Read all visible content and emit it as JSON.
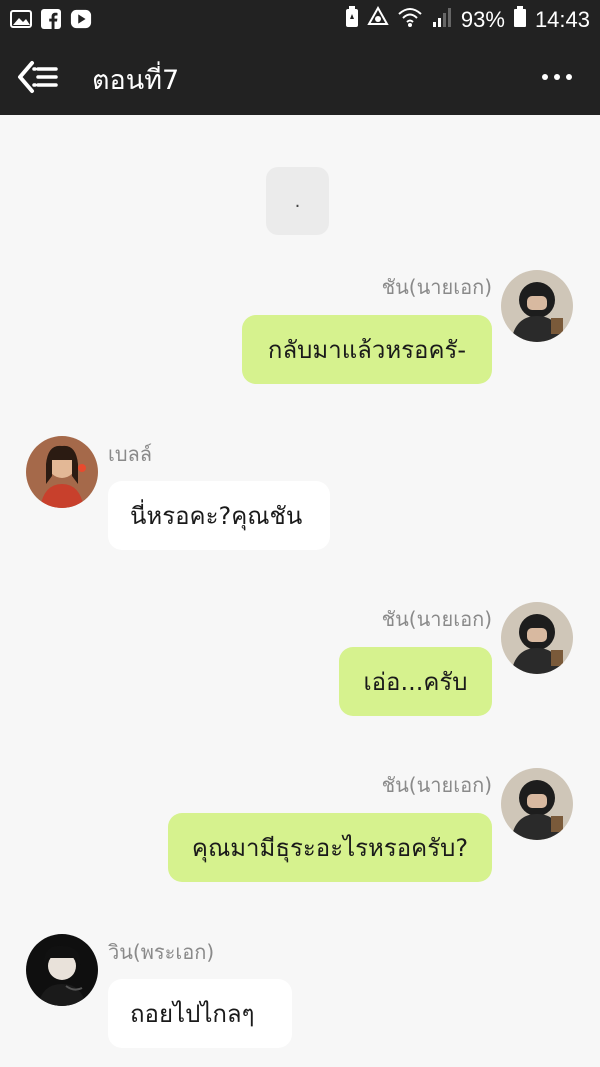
{
  "status_bar": {
    "battery_percent": "93%",
    "time": "14:43",
    "icons": [
      "gallery-icon",
      "facebook-icon",
      "youtube-icon",
      "battery-saver-icon",
      "data-saver-icon",
      "wifi-icon",
      "signal-icon",
      "battery-icon"
    ]
  },
  "app_bar": {
    "title": "ตอนที่7",
    "back_icon": "back-list-icon",
    "menu_icon": "more-dots-icon"
  },
  "chat": {
    "system_message": ".",
    "messages": [
      {
        "sender": "ชัน(นายเอก)",
        "text": "กลับมาแล้วหรอครั-",
        "side": "right"
      },
      {
        "sender": "เบลล์",
        "text": "นี่หรอคะ?คุณชัน",
        "side": "left"
      },
      {
        "sender": "ชัน(นายเอก)",
        "text": "เอ่อ...ครับ",
        "side": "right"
      },
      {
        "sender": "ชัน(นายเอก)",
        "text": "คุณมามีธุระอะไรหรอครับ?",
        "side": "right"
      },
      {
        "sender": "วิน(พระเอก)",
        "text": "ถอยไปไกลๆ",
        "side": "left"
      }
    ]
  },
  "colors": {
    "bar_bg": "#222222",
    "chat_bg": "#f7f7f7",
    "outgoing_bubble": "#d6f28e",
    "incoming_bubble": "#ffffff",
    "name_text": "#8a8a8a"
  }
}
